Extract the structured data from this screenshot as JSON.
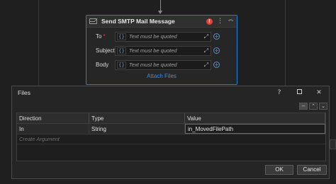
{
  "activity": {
    "title": "Send SMTP Mail Message",
    "error_badge": "!",
    "menu_glyph": "⋮",
    "collapse_glyph": "︽",
    "fields": [
      {
        "label": "To",
        "required": "*",
        "placeholder": "Text must be quoted"
      },
      {
        "label": "Subject",
        "required": "",
        "placeholder": "Text must be quoted"
      },
      {
        "label": "Body",
        "required": "",
        "placeholder": "Text must be quoted"
      }
    ],
    "attach_label": "Attach Files"
  },
  "dialog": {
    "title": "Files",
    "help": "?",
    "columns": [
      "Direction",
      "Type",
      "Value"
    ],
    "rows": [
      {
        "direction": "In",
        "type": "String",
        "value": "in_MovedFilePath"
      }
    ],
    "create_argument": "Create Argument",
    "ok_label": "OK",
    "cancel_label": "Cancel"
  },
  "colors": {
    "accent": "#1f7fd6",
    "link": "#3f8ee0",
    "error": "#e0433a"
  }
}
